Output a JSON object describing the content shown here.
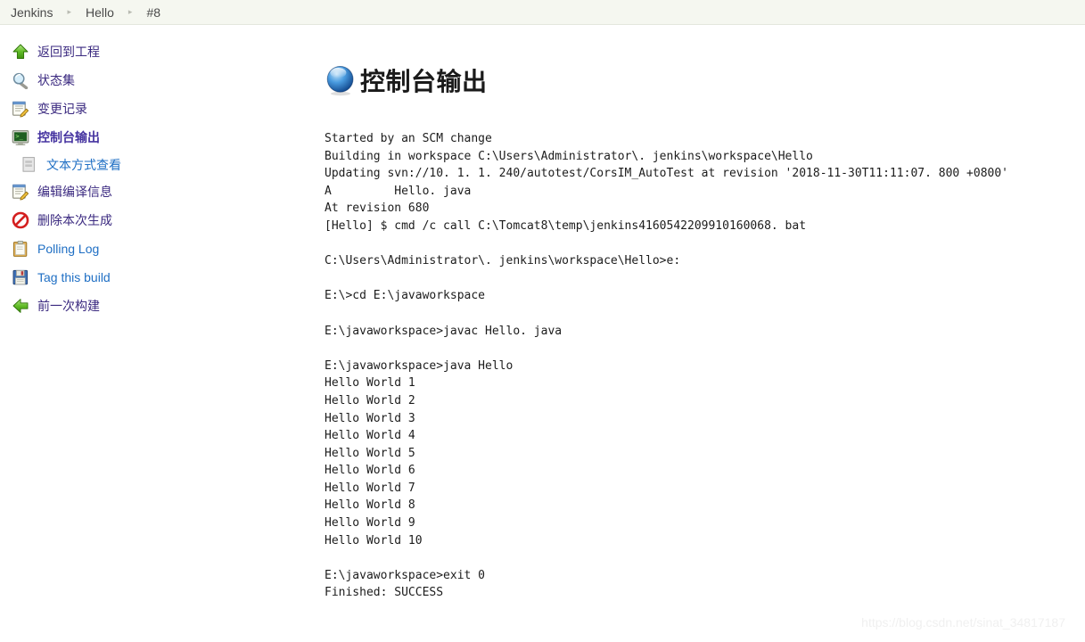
{
  "breadcrumb": {
    "items": [
      {
        "label": "Jenkins"
      },
      {
        "label": "Hello"
      },
      {
        "label": "#8"
      }
    ],
    "separator": "▸"
  },
  "sidebar": {
    "items": [
      {
        "label": "返回到工程",
        "icon": "up-arrow-icon",
        "state": "visited",
        "indent": false
      },
      {
        "label": "状态集",
        "icon": "magnifier-icon",
        "state": "visited",
        "indent": false
      },
      {
        "label": "变更记录",
        "icon": "notepad-edit-icon",
        "state": "visited",
        "indent": false
      },
      {
        "label": "控制台输出",
        "icon": "terminal-icon",
        "state": "current",
        "indent": false
      },
      {
        "label": "文本方式查看",
        "icon": "document-icon",
        "state": "fresh",
        "indent": true
      },
      {
        "label": "编辑编译信息",
        "icon": "notepad-edit-icon",
        "state": "visited",
        "indent": false
      },
      {
        "label": "删除本次生成",
        "icon": "no-entry-icon",
        "state": "visited",
        "indent": false
      },
      {
        "label": "Polling Log",
        "icon": "clipboard-icon",
        "state": "fresh",
        "indent": false
      },
      {
        "label": "Tag this build",
        "icon": "floppy-disk-icon",
        "state": "fresh",
        "indent": false
      },
      {
        "label": "前一次构建",
        "icon": "left-arrow-icon",
        "state": "visited",
        "indent": false
      }
    ]
  },
  "main": {
    "title": "控制台输出",
    "title_icon": "blue-globe-icon",
    "console_text": "Started by an SCM change\nBuilding in workspace C:\\Users\\Administrator\\. jenkins\\workspace\\Hello\nUpdating svn://10. 1. 1. 240/autotest/CorsIM_AutoTest at revision '2018-11-30T11:11:07. 800 +0800'\nA         Hello. java\nAt revision 680\n[Hello] $ cmd /c call C:\\Tomcat8\\temp\\jenkins4160542209910160068. bat\n\nC:\\Users\\Administrator\\. jenkins\\workspace\\Hello>e:\n\nE:\\>cd E:\\javaworkspace\n\nE:\\javaworkspace>javac Hello. java\n\nE:\\javaworkspace>java Hello\nHello World 1\nHello World 2\nHello World 3\nHello World 4\nHello World 5\nHello World 6\nHello World 7\nHello World 8\nHello World 9\nHello World 10\n\nE:\\javaworkspace>exit 0\nFinished: SUCCESS"
  },
  "watermark": {
    "text": "https://blog.csdn.net/sinat_34817187"
  },
  "colors": {
    "link_visited": "#3b2a80",
    "link_fresh": "#1f6fc4",
    "breadcrumb_bg": "#f5f7f0",
    "console_text": "#1c1c1c"
  }
}
